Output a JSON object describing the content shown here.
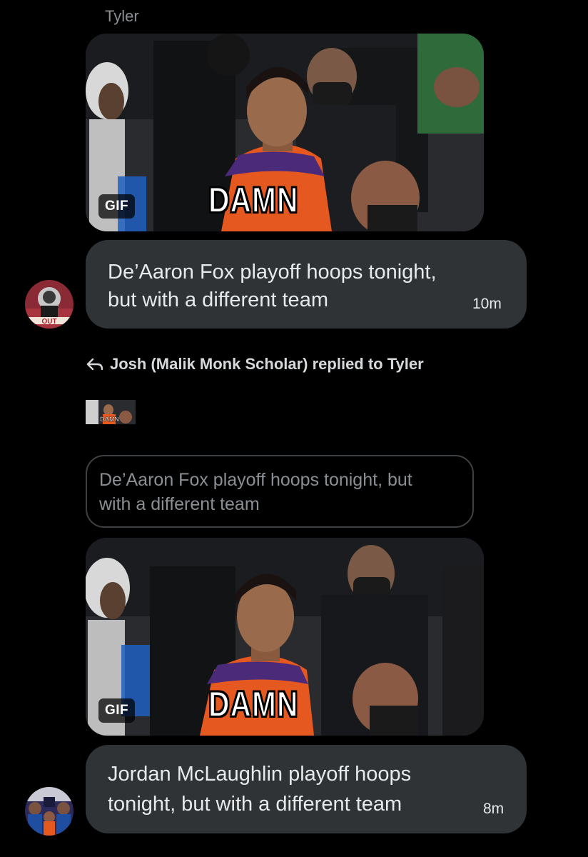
{
  "thread": {
    "sender_name": "Tyler"
  },
  "messages": [
    {
      "gif": {
        "badge": "GIF",
        "caption": "DAMN"
      },
      "text": "De’Aaron Fox playoff hoops tonight, but with a different team",
      "text_line1": "De’Aaron Fox playoff hoops tonight,",
      "text_line2": "but with a different team",
      "time": "10m"
    },
    {
      "reply_to": "Josh (Malik Monk Scholar) replied to Tyler",
      "quoted_text": "De’Aaron Fox playoff hoops tonight, but with a different team",
      "quoted_line1": "De’Aaron Fox playoff hoops tonight, but",
      "quoted_line2": "with a different team",
      "thumb_caption": "DAMN",
      "gif": {
        "badge": "GIF",
        "caption": "DAMN"
      },
      "text_line1": "Jordan McLaughlin playoff hoops",
      "text_line2": "tonight, but with a different team",
      "time": "8m"
    }
  ],
  "icons": {
    "reply": "reply-arrow-icon",
    "gif_badge": "gif-badge"
  },
  "colors": {
    "background": "#000000",
    "bubble": "#2f3336",
    "muted_text": "#8b8f94",
    "jersey_purple": "#4b2a7a",
    "jersey_orange": "#e5581f"
  }
}
